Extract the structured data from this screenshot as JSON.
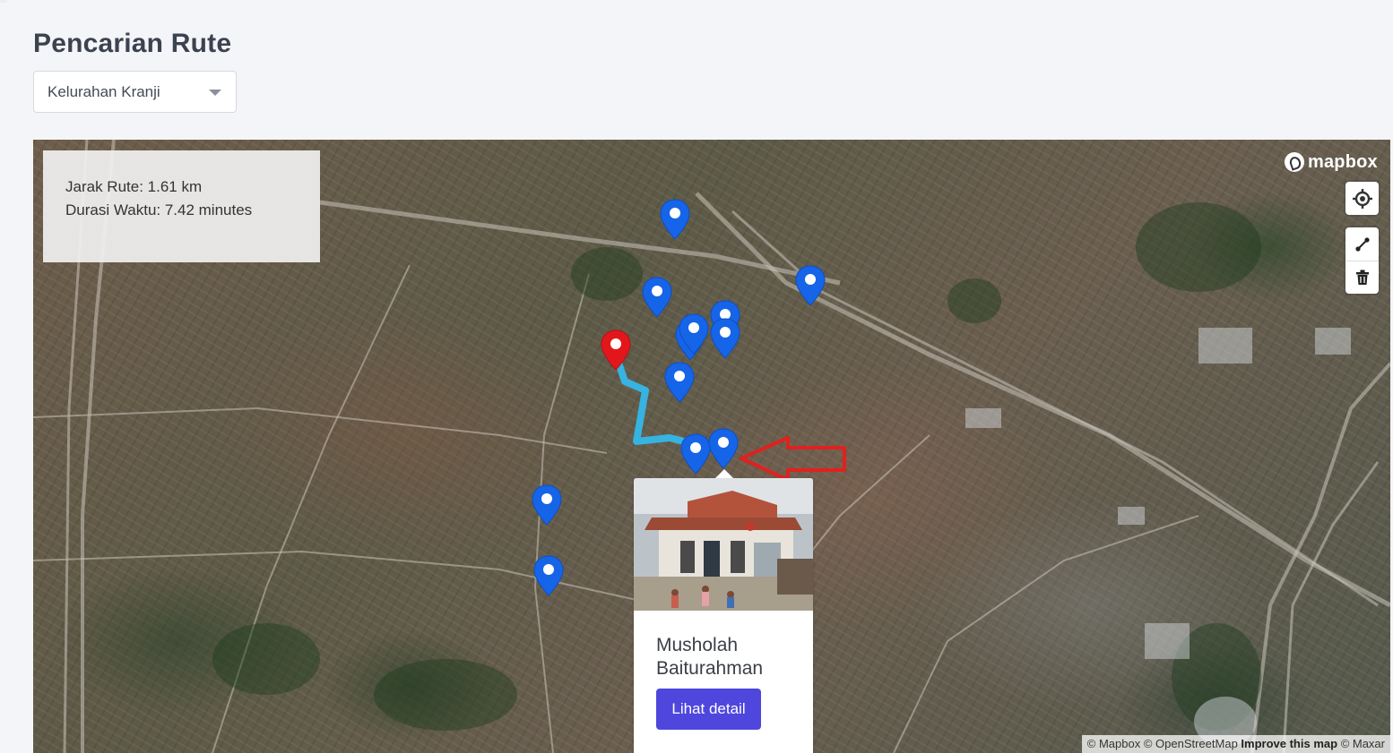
{
  "page": {
    "title": "Pencarian Rute"
  },
  "region_select": {
    "selected": "Kelurahan Kranji"
  },
  "route_info": {
    "distance_text": "Jarak Rute: 1.61 km",
    "duration_text": "Durasi Waktu: 7.42 minutes"
  },
  "map": {
    "logo_text": "mapbox",
    "controls": {
      "geolocate_icon": "target-icon",
      "draw_line_icon": "line-draw-icon",
      "trash_icon": "trash-icon"
    },
    "colors": {
      "route": "#36b3e0",
      "marker_blue": "#1664e8",
      "marker_red": "#e3171b",
      "annotation_arrow": "#e0211e"
    },
    "attribution": {
      "mapbox": "© Mapbox",
      "osm": "© OpenStreetMap",
      "improve": "Improve this map",
      "maxar": "© Maxar"
    }
  },
  "popup": {
    "title": "Musholah Baiturahman",
    "button_label": "Lihat detail"
  }
}
